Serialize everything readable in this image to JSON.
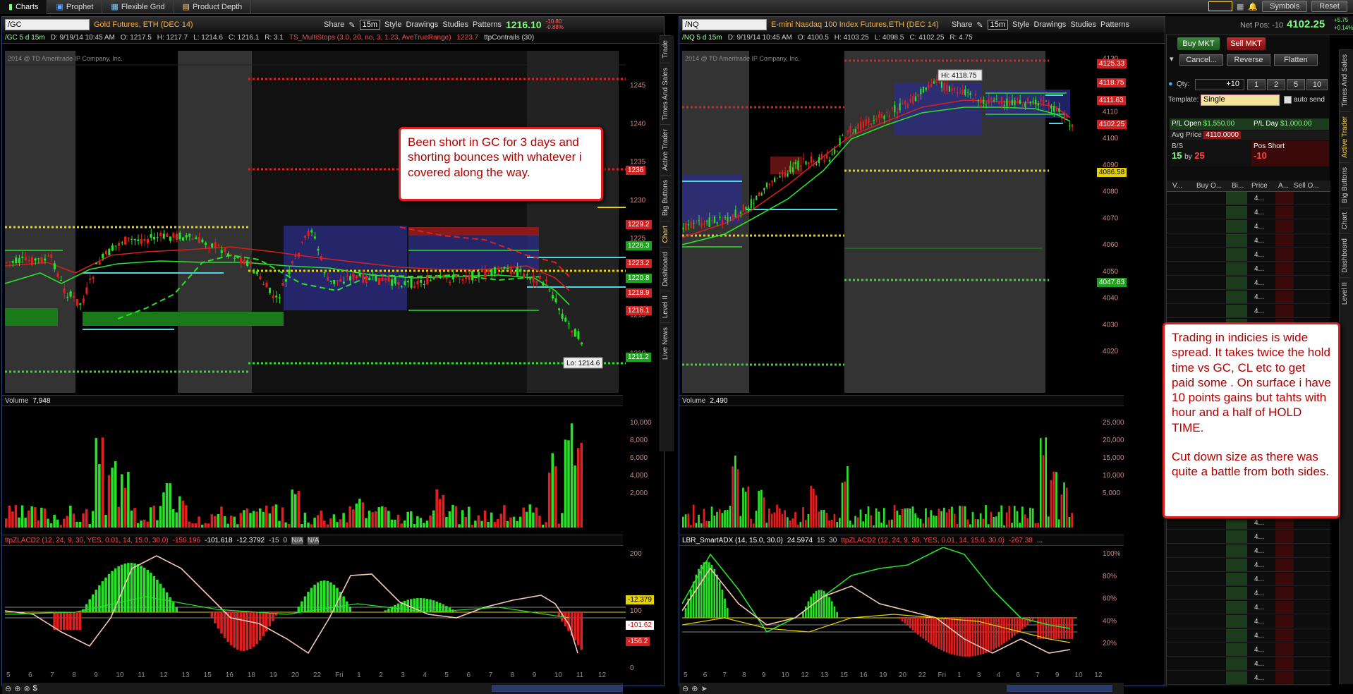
{
  "topbar": {
    "tabs": [
      {
        "label": "Charts",
        "icon": "chart-icon",
        "active": true
      },
      {
        "label": "Prophet",
        "icon": "prophet-icon",
        "active": false
      },
      {
        "label": "Flexible Grid",
        "icon": "grid-icon",
        "active": false
      },
      {
        "label": "Product Depth",
        "icon": "depth-icon",
        "active": false
      }
    ],
    "symbols_label": "Symbols",
    "reset_label": "Reset"
  },
  "left_chart": {
    "symbol": "/GC",
    "instrument": "Gold Futures, ETH (DEC 14)",
    "share": "Share",
    "timeframe": "15m",
    "style": "Style",
    "drawings": "Drawings",
    "studies": "Studies",
    "patterns": "Patterns",
    "last_price": "1216.10",
    "change_1": "-10.80",
    "change_2": "-0.88%",
    "info": [
      "/GC 5 d 15m",
      "D: 9/19/14 10:45 AM",
      "O: 1217.5",
      "H: 1217.7",
      "L: 1214.6",
      "C: 1216.1",
      "R: 3.1"
    ],
    "study_label": "TS_MultiStops (3.0, 20, no, 3, 1.23, AveTrueRange)",
    "study_value": "1223.7",
    "study_label2": "ttpContrails (30)",
    "copyright": "2014 @ TD Ameritrade IP Company, Inc.",
    "y_ticks": [
      "1245",
      "1240",
      "1235",
      "1230",
      "1225",
      "1220",
      "1215",
      "1210"
    ],
    "price_boxes": [
      {
        "label": "1236",
        "color": "#d42020"
      },
      {
        "label": "1229.2",
        "color": "#d42020"
      },
      {
        "label": "1226.3",
        "color": "#1fa31f"
      },
      {
        "label": "1223.2",
        "color": "#d42020"
      },
      {
        "label": "1220.8",
        "color": "#1fa31f"
      },
      {
        "label": "1218.9",
        "color": "#d42020"
      },
      {
        "label": "1216.1",
        "color": "#d42020"
      },
      {
        "label": "1211.2",
        "color": "#1fa31f"
      }
    ],
    "lo_label": "Lo: 1214.6",
    "volume_label": "Volume",
    "volume_value": "7,948",
    "volume_ticks": [
      "10,000",
      "8,000",
      "6,000",
      "4,000",
      "2,000"
    ],
    "osc_labels": [
      "ttpZLACD2 (12, 24, 9, 30, YES, 0.01, 14, 15.0, 30.0)",
      "-156.196",
      "-101.618",
      "-12.3792",
      "-15",
      "0",
      "N/A",
      "N/A"
    ],
    "osc_ticks": [
      "200",
      "100",
      "0"
    ],
    "osc_boxes": [
      {
        "label": "-12.379",
        "color": "#e6d200",
        "text": "#000"
      },
      {
        "label": "-101.62",
        "color": "#ffffff",
        "text": "#c00"
      },
      {
        "label": "-156.2",
        "color": "#d42020",
        "text": "#fff"
      }
    ],
    "x_ticks": [
      "5",
      "6",
      "7",
      "8",
      "9",
      "10",
      "11",
      "12",
      "13",
      "15",
      "16",
      "18",
      "19",
      "20",
      "22",
      "Fri",
      "1",
      "2",
      "3",
      "4",
      "5",
      "6",
      "7",
      "8",
      "9",
      "10",
      "11",
      "12"
    ]
  },
  "right_chart": {
    "symbol": "/NQ",
    "instrument": "E-mini Nasdaq 100 Index Futures,ETH (DEC 14)",
    "share": "Share",
    "timeframe": "15m",
    "style": "Style",
    "drawings": "Drawings",
    "studies": "Studies",
    "patterns": "Patterns",
    "info": [
      "/NQ 5 d 15m",
      "D: 9/19/14 10:45 AM",
      "O: 4100.5",
      "H: 4103.25",
      "L: 4098.5",
      "C: 4102.25",
      "R: 4.75"
    ],
    "copyright": "2014 @ TD Ameritrade IP Company, Inc.",
    "hi_label": "Hi: 4118.75",
    "y_ticks": [
      "4130",
      "4120",
      "4110",
      "4100",
      "4090",
      "4080",
      "4070",
      "4060",
      "4050",
      "4040",
      "4030",
      "4020"
    ],
    "price_boxes": [
      {
        "label": "4125.33",
        "color": "#d42020"
      },
      {
        "label": "4118.75",
        "color": "#d42020"
      },
      {
        "label": "4111.63",
        "color": "#d42020"
      },
      {
        "label": "4102.25",
        "color": "#d42020"
      },
      {
        "label": "4086.58",
        "color": "#e6d200"
      },
      {
        "label": "4047.83",
        "color": "#1fa31f"
      }
    ],
    "volume_label": "Volume",
    "volume_value": "2,490",
    "volume_ticks": [
      "25,000",
      "20,000",
      "15,000",
      "10,000",
      "5,000"
    ],
    "osc_labels": [
      "LBR_SmartADX (14, 15.0, 30.0)",
      "24.5974",
      "15",
      "30",
      "ttpZLACD2 (12, 24, 9, 30, YES, 0.01, 14, 15.0, 30.0)",
      "-267.38",
      "..."
    ],
    "osc_ticks": [
      "100%",
      "80%",
      "60%",
      "40%",
      "20%"
    ],
    "x_ticks": [
      "5",
      "6",
      "7",
      "8",
      "9",
      "10",
      "12",
      "13",
      "15",
      "16",
      "19",
      "20",
      "22",
      "Fri",
      "1",
      "3",
      "4",
      "6",
      "7",
      "9",
      "10",
      "12"
    ]
  },
  "side_tabs_left": [
    "Trade",
    "Times And Sales",
    "Active Trader",
    "Big Buttons",
    "Chart",
    "Dashboard",
    "Level II",
    "Live News"
  ],
  "side_tabs_right": [
    "Times And Sales",
    "Active Trader",
    "Big Buttons",
    "Chart",
    "Dashboard",
    "Level II"
  ],
  "active_trader": {
    "net_pos_label": "Net Pos: -10",
    "last_price": "4102.25",
    "chg1": "+5.75",
    "chg2": "+0.14%",
    "buy_mkt": "Buy MKT",
    "sell_mkt": "Sell MKT",
    "cancel": "Cancel...",
    "reverse": "Reverse",
    "flatten": "Flatten",
    "qty_label": "Qty:",
    "qty_value": "+10",
    "qty_buttons": [
      "1",
      "2",
      "5",
      "10"
    ],
    "template_label": "Template:",
    "template_value": "Single",
    "auto_send": "auto send",
    "pl_open_label": "P/L Open",
    "pl_open": "$1,550.00",
    "pl_day_label": "P/L Day",
    "pl_day": "$1,000.00",
    "avg_price_label": "Avg Price",
    "avg_price": "4110.0000",
    "bs_label": "B/S",
    "bs_buy": "15",
    "bs_by": "by",
    "bs_sell": "25",
    "pos_label": "Pos Short",
    "pos_value": "-10",
    "ladder_headers": [
      "V...",
      "Buy O...",
      "Bi...",
      "Price",
      "A...",
      "Sell O..."
    ],
    "ladder_price": "4..."
  },
  "annotations": {
    "gc": "Been short in GC for 3 days and shorting bounces with whatever i covered along the way.",
    "nq_1": "Trading in indicies is wide spread. It takes twice the hold time vs GC, CL etc to get paid some .  On surface i have 10 points gains but tahts with hour and a half of HOLD TIME.",
    "nq_2": "Cut down size as there was quite a battle from both sides."
  }
}
